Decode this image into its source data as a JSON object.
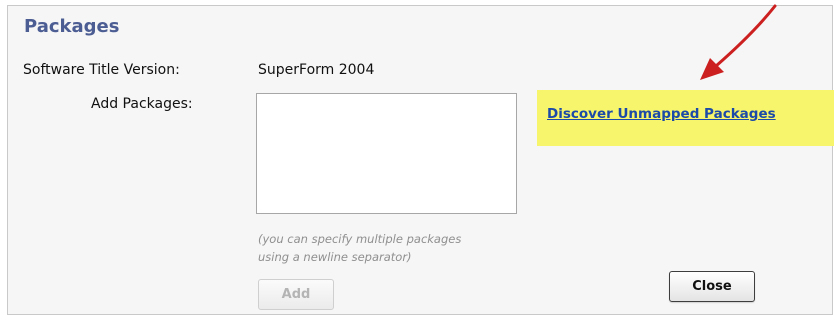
{
  "panel": {
    "title": "Packages"
  },
  "form": {
    "version_label": "Software Title Version:",
    "version_value": "SuperForm 2004",
    "add_packages_label": "Add Packages:",
    "add_packages_value": "",
    "hint_line1": "(you can specify multiple packages",
    "hint_line2": "using a newline separator)",
    "add_button": "Add",
    "close_button": "Close",
    "discover_link": "Discover Unmapped Packages"
  },
  "icons": {
    "annotation": "red-arrow-icon"
  },
  "colors": {
    "title": "#4c5d93",
    "link": "#1c4aa8",
    "highlight": "#f6f56c",
    "arrow": "#cc1f1f"
  }
}
